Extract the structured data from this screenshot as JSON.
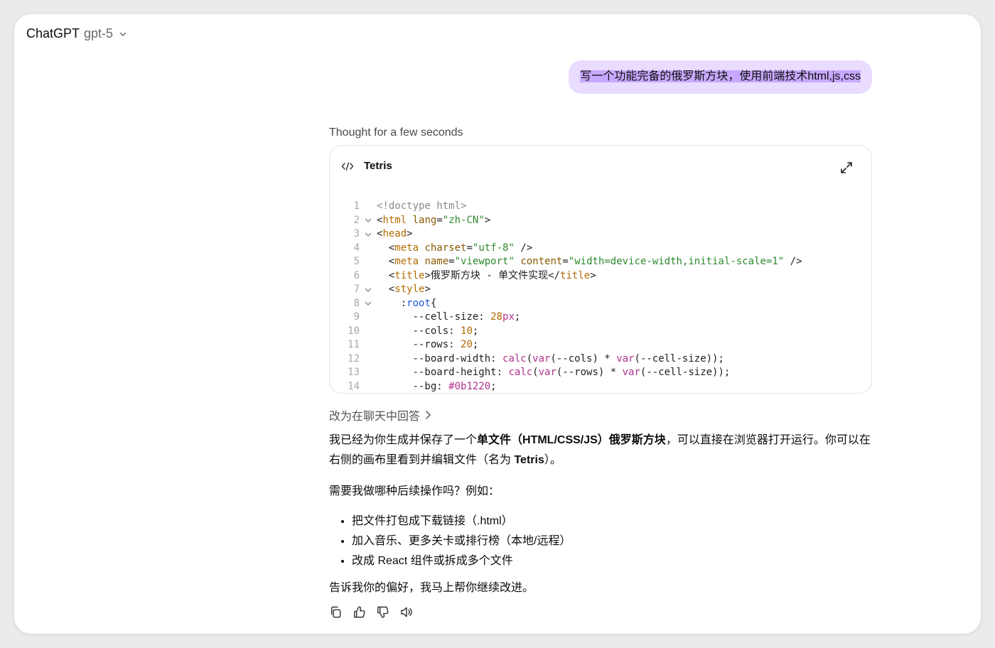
{
  "header": {
    "app_name": "ChatGPT",
    "model": "gpt-5"
  },
  "user_message": "写一个功能完备的俄罗斯方块，使用前端技术html,js,css",
  "thought": "Thought for a few seconds",
  "canvas": {
    "title": "Tetris",
    "code": [
      {
        "n": "1",
        "fold": false,
        "html": "<span class='cmt'>&lt;!doctype html&gt;</span>"
      },
      {
        "n": "2",
        "fold": true,
        "html": "&lt;<span class='tag'>html</span> <span class='attr'>lang</span>=<span class='str'>\"zh-CN\"</span>&gt;"
      },
      {
        "n": "3",
        "fold": true,
        "html": "&lt;<span class='tag'>head</span>&gt;"
      },
      {
        "n": "4",
        "fold": false,
        "html": "  &lt;<span class='tag'>meta</span> <span class='attr'>charset</span>=<span class='str'>\"utf-8\"</span> /&gt;"
      },
      {
        "n": "5",
        "fold": false,
        "html": "  &lt;<span class='tag'>meta</span> <span class='attr'>name</span>=<span class='str'>\"viewport\"</span> <span class='attr'>content</span>=<span class='str'>\"width=device-width,initial-scale=1\"</span> /&gt;"
      },
      {
        "n": "6",
        "fold": false,
        "html": "  &lt;<span class='tag'>title</span>&gt;俄罗斯方块 - 单文件实现&lt;/<span class='tag'>title</span>&gt;"
      },
      {
        "n": "7",
        "fold": true,
        "html": "  &lt;<span class='tag'>style</span>&gt;"
      },
      {
        "n": "8",
        "fold": true,
        "html": "    :<span class='kw'>root</span>{"
      },
      {
        "n": "9",
        "fold": false,
        "html": "      --cell-size: <span class='num'>28</span><span class='fn'>px</span>;"
      },
      {
        "n": "10",
        "fold": false,
        "html": "      --cols: <span class='num'>10</span>;"
      },
      {
        "n": "11",
        "fold": false,
        "html": "      --rows: <span class='num'>20</span>;"
      },
      {
        "n": "12",
        "fold": false,
        "html": "      --board-width: <span class='fn'>calc</span>(<span class='fn'>var</span>(--cols) * <span class='fn'>var</span>(--cell-size));"
      },
      {
        "n": "13",
        "fold": false,
        "html": "      --board-height: <span class='fn'>calc</span>(<span class='fn'>var</span>(--rows) * <span class='fn'>var</span>(--cell-size));"
      },
      {
        "n": "14",
        "fold": false,
        "html": "      --bg: <span class='fn'>#0b1220</span>;"
      }
    ]
  },
  "switch_to_chat": "改为在聊天中回答",
  "reply": {
    "p1_a": "我已经为你生成并保存了一个",
    "p1_bold": "单文件（HTML/CSS/JS）俄罗斯方块",
    "p1_b": "，可以直接在浏览器打开运行。你可以在右侧的画布里看到并编辑文件（名为 ",
    "p1_bold2": "Tetris",
    "p1_c": "）。",
    "p2": "需要我做哪种后续操作吗？例如：",
    "bullets": [
      "把文件打包成下载链接（.html）",
      "加入音乐、更多关卡或排行榜（本地/远程）",
      "改成 React 组件或拆成多个文件"
    ],
    "p3": "告诉我你的偏好，我马上帮你继续改进。"
  },
  "icons": {
    "copy": "copy-icon",
    "like": "thumbs-up-icon",
    "dislike": "thumbs-down-icon",
    "read_aloud": "speaker-icon"
  }
}
